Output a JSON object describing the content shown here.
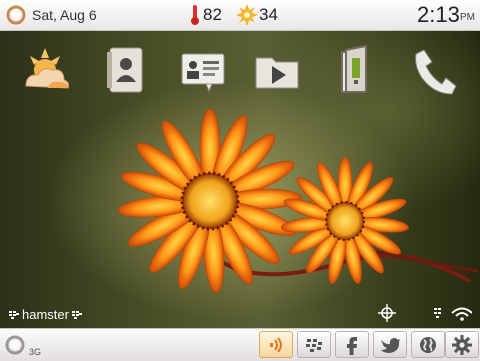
{
  "status_bar": {
    "date": "Sat, Aug 6",
    "temperature": "82",
    "weather_value": "34",
    "time": "2:13",
    "ampm": "PM"
  },
  "home_icons": [
    {
      "name": "weather-app-icon"
    },
    {
      "name": "contacts-app-icon"
    },
    {
      "name": "contact-card-app-icon"
    },
    {
      "name": "media-folder-app-icon"
    },
    {
      "name": "app-world-app-icon"
    },
    {
      "name": "phone-app-icon"
    }
  ],
  "carrier": {
    "label": "hamster"
  },
  "network": {
    "label": "3G"
  },
  "tray_icons": [
    "notifications-icon",
    "bbm-icon",
    "facebook-icon",
    "twitter-icon",
    "browser-globe-icon",
    "settings-gear-icon"
  ],
  "colors": {
    "topbar": "#f4f2f2",
    "accent": "#f0a040",
    "wallpaper_dark": "#2c3118"
  }
}
